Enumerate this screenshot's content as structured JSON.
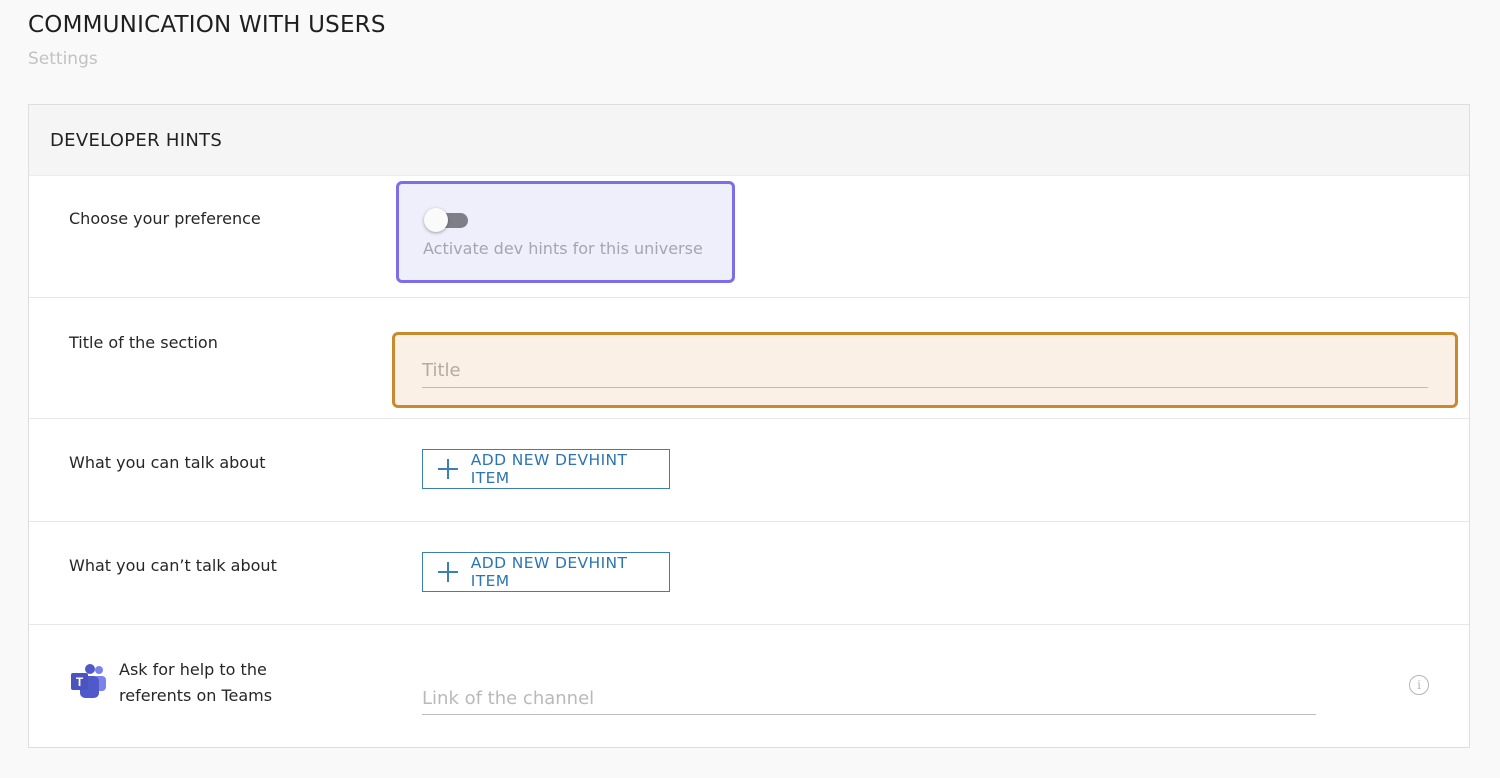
{
  "page": {
    "title": "COMMUNICATION WITH USERS",
    "subtitle": "Settings"
  },
  "card": {
    "header": "DEVELOPER HINTS",
    "preference": {
      "label": "Choose your preference",
      "toggle_caption": "Activate dev hints for this universe",
      "toggle_on": false
    },
    "section_title": {
      "label": "Title of the section",
      "placeholder": "Title",
      "value": ""
    },
    "can_talk": {
      "label": "What you can talk about",
      "button_label": "ADD NEW DEVHINT ITEM"
    },
    "cant_talk": {
      "label": "What you can’t talk about",
      "button_label": "ADD NEW DEVHINT ITEM"
    },
    "teams": {
      "label_line1": "Ask for help to the",
      "label_line2": "referents on Teams",
      "placeholder": "Link of the channel",
      "info_glyph": "i"
    }
  },
  "colors": {
    "toggle_highlight": "#7b6ee8",
    "title_highlight": "#c98a2e",
    "button_blue": "#2c75b4",
    "teams_purple": "#5059c9"
  }
}
